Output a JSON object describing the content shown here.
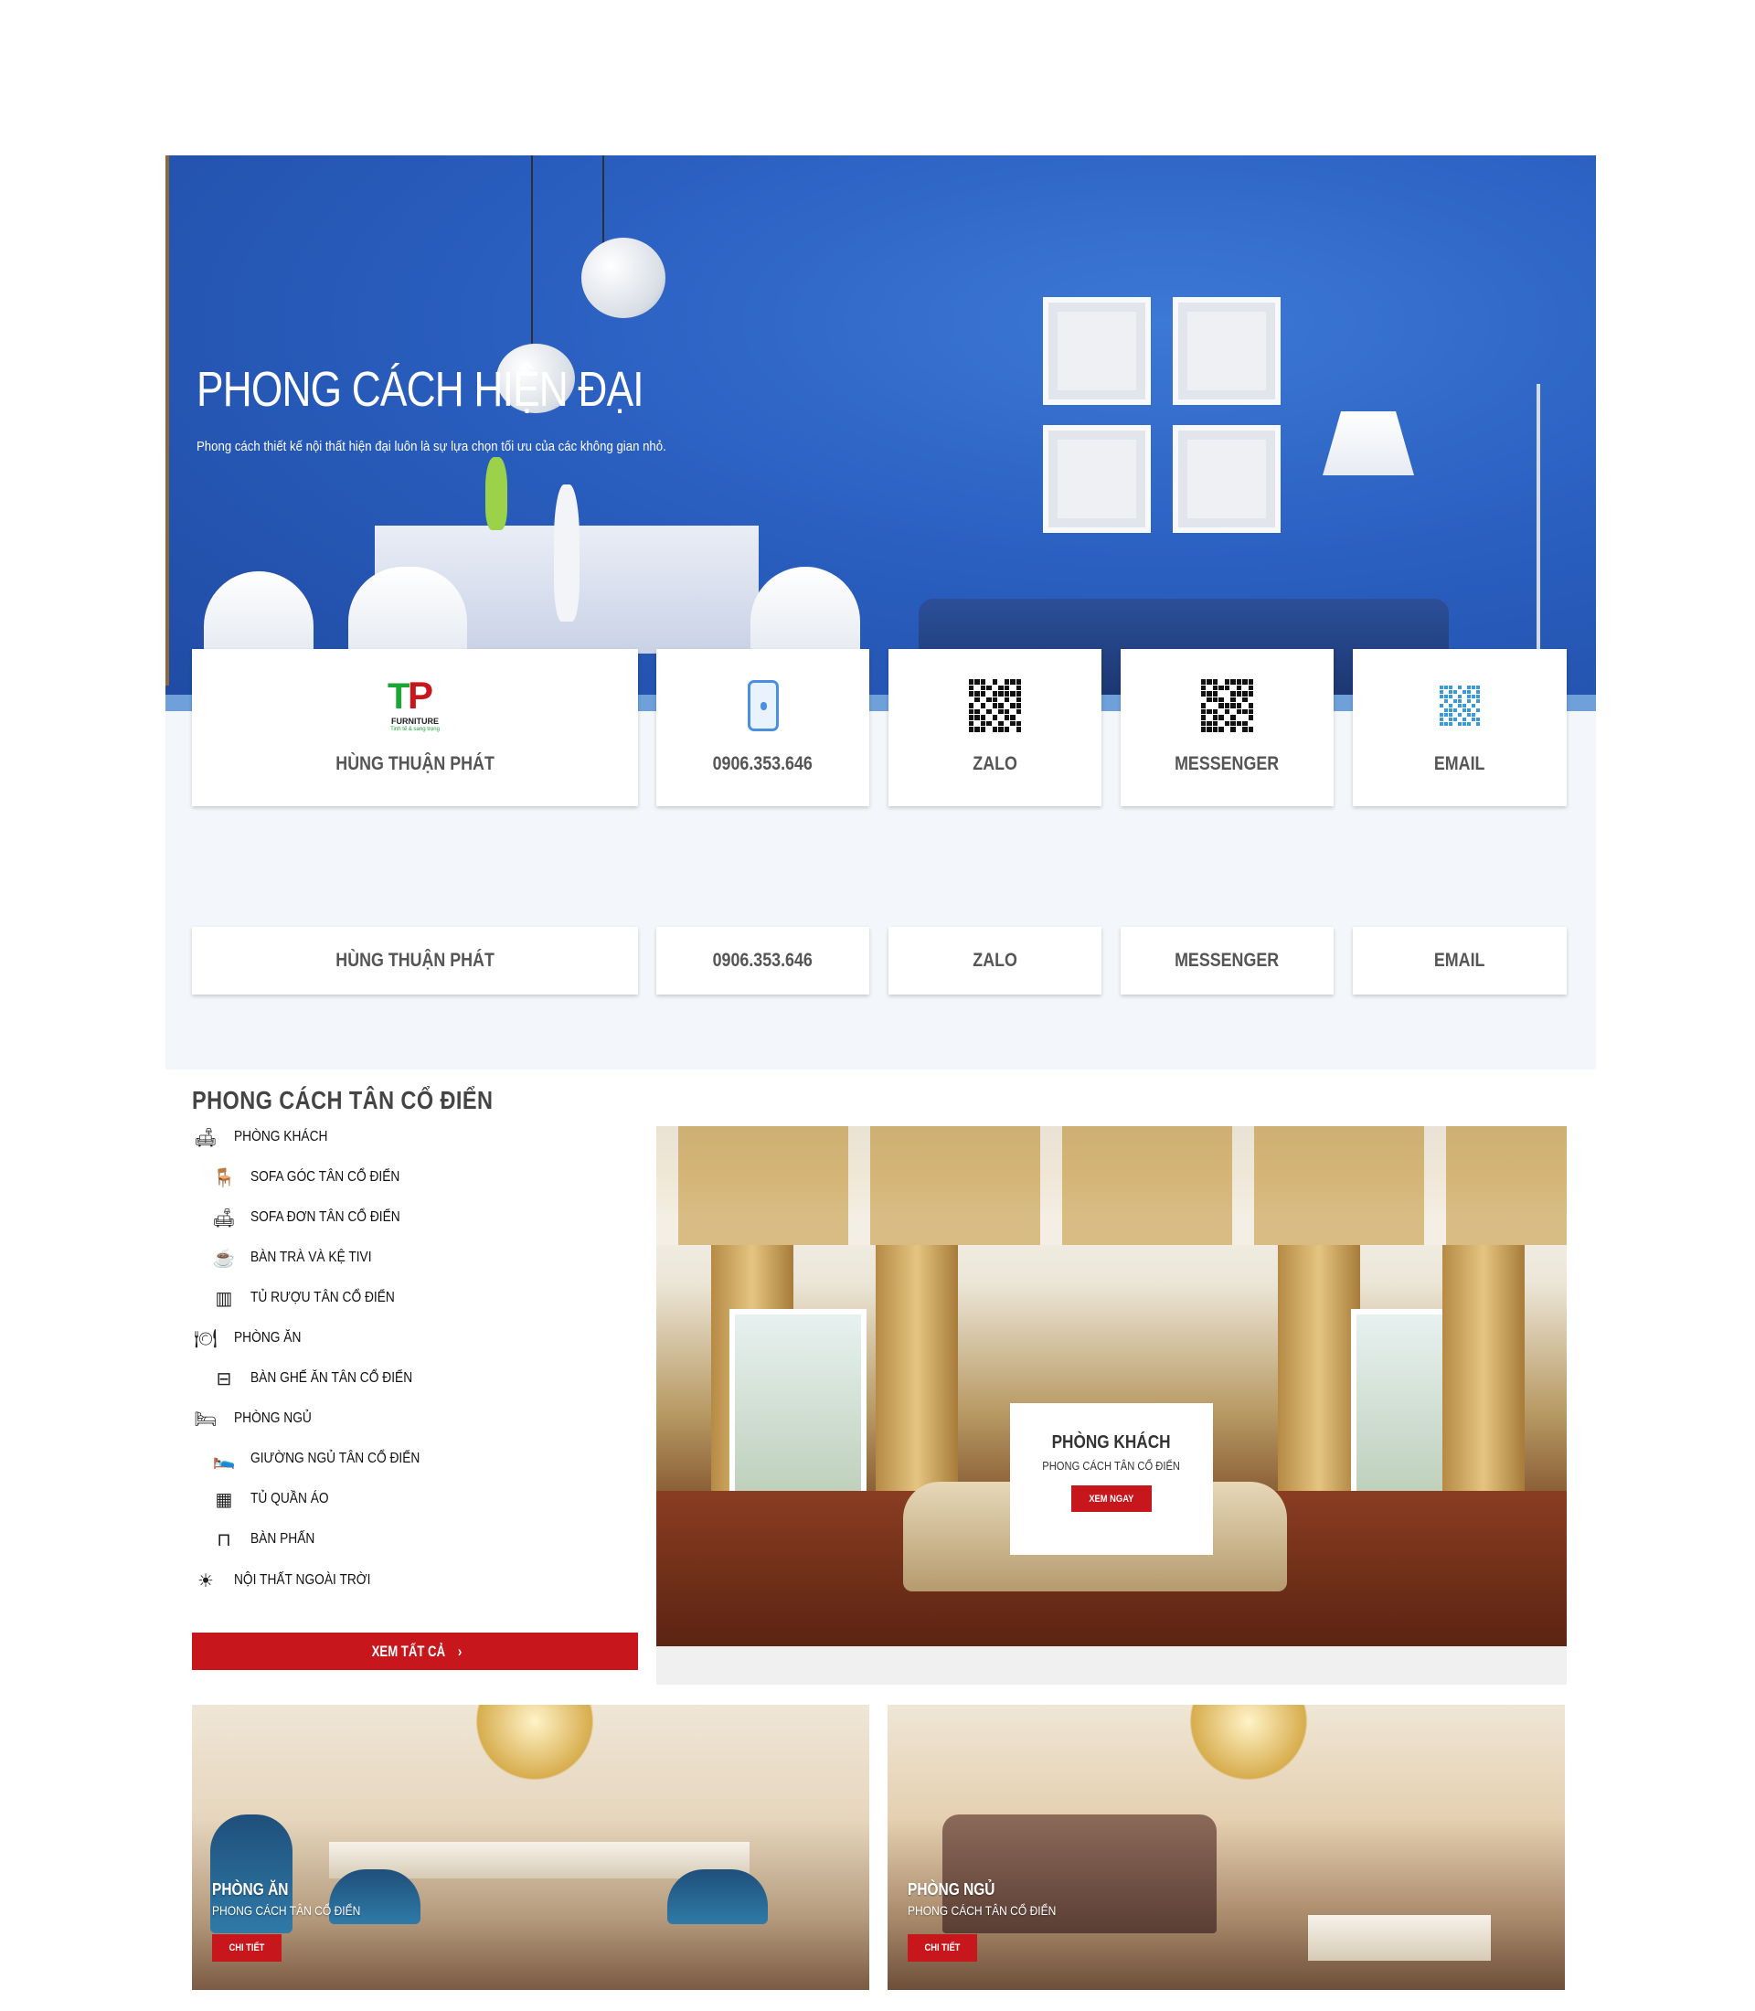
{
  "hero": {
    "title": "PHONG CÁCH HIỆN ĐẠI",
    "subtitle": "Phong cách thiết kế nội thất hiện đại luôn là sự lựa chọn tối ưu của các không gian nhỏ."
  },
  "contacts": [
    {
      "label": "HÙNG THUẬN PHÁT",
      "icon": "brand-logo-icon"
    },
    {
      "label": "0906.353.646",
      "icon": "phone-icon"
    },
    {
      "label": "ZALO",
      "icon": "qr-code-icon"
    },
    {
      "label": "MESSENGER",
      "icon": "qr-code-icon"
    },
    {
      "label": "EMAIL",
      "icon": "qr-code-icon"
    }
  ],
  "brand": {
    "logo_text": "FURNITURE",
    "logo_tagline": "Tinh tế & sang trọng"
  },
  "classic": {
    "title": "PHONG CÁCH TÂN CỔ ĐIỂN",
    "menu": [
      {
        "label": "PHÒNG KHÁCH",
        "icon": "living-room-icon"
      },
      {
        "label": "SOFA GÓC TÂN CỔ ĐIỂN",
        "icon": "armchair-icon"
      },
      {
        "label": "SOFA ĐƠN TÂN CỔ ĐIỂN",
        "icon": "sofa-icon"
      },
      {
        "label": "BÀN TRÀ VÀ KỆ TIVI",
        "icon": "tea-table-icon"
      },
      {
        "label": "TỦ RƯỢU TÂN CỔ ĐIỂN",
        "icon": "cabinet-icon"
      },
      {
        "label": "PHÒNG ĂN",
        "icon": "dining-plate-icon"
      },
      {
        "label": "BÀN GHẾ ĂN TÂN CỔ ĐIỂN",
        "icon": "dining-table-icon"
      },
      {
        "label": "PHÒNG NGỦ",
        "icon": "bunk-bed-icon"
      },
      {
        "label": "GIƯỜNG NGỦ TÂN CỔ ĐIỂN",
        "icon": "sleeping-bed-icon"
      },
      {
        "label": "TỦ QUẦN ÁO",
        "icon": "wardrobe-icon"
      },
      {
        "label": "BÀN PHẤN",
        "icon": "dresser-icon"
      },
      {
        "label": "NỘI THẤT NGOÀI TRỜI",
        "icon": "sun-icon"
      }
    ],
    "view_all": "XEM TẤT CẢ",
    "feature": {
      "title": "PHÒNG KHÁCH",
      "subtitle": "PHONG CÁCH TÂN CỔ ĐIỂN",
      "button": "XEM NGAY"
    },
    "tiles": [
      {
        "title": "PHÒNG ĂN",
        "subtitle": "PHONG CÁCH TÂN CỔ ĐIỂN",
        "button": "CHI TIẾT"
      },
      {
        "title": "PHÒNG NGỦ",
        "subtitle": "PHONG CÁCH TÂN CỔ ĐIỂN",
        "button": "CHI TIẾT"
      }
    ]
  },
  "colors": {
    "accent_red": "#c8161d",
    "hero_blue": "#2a5fc0",
    "section_bg": "#f3f6fa"
  }
}
